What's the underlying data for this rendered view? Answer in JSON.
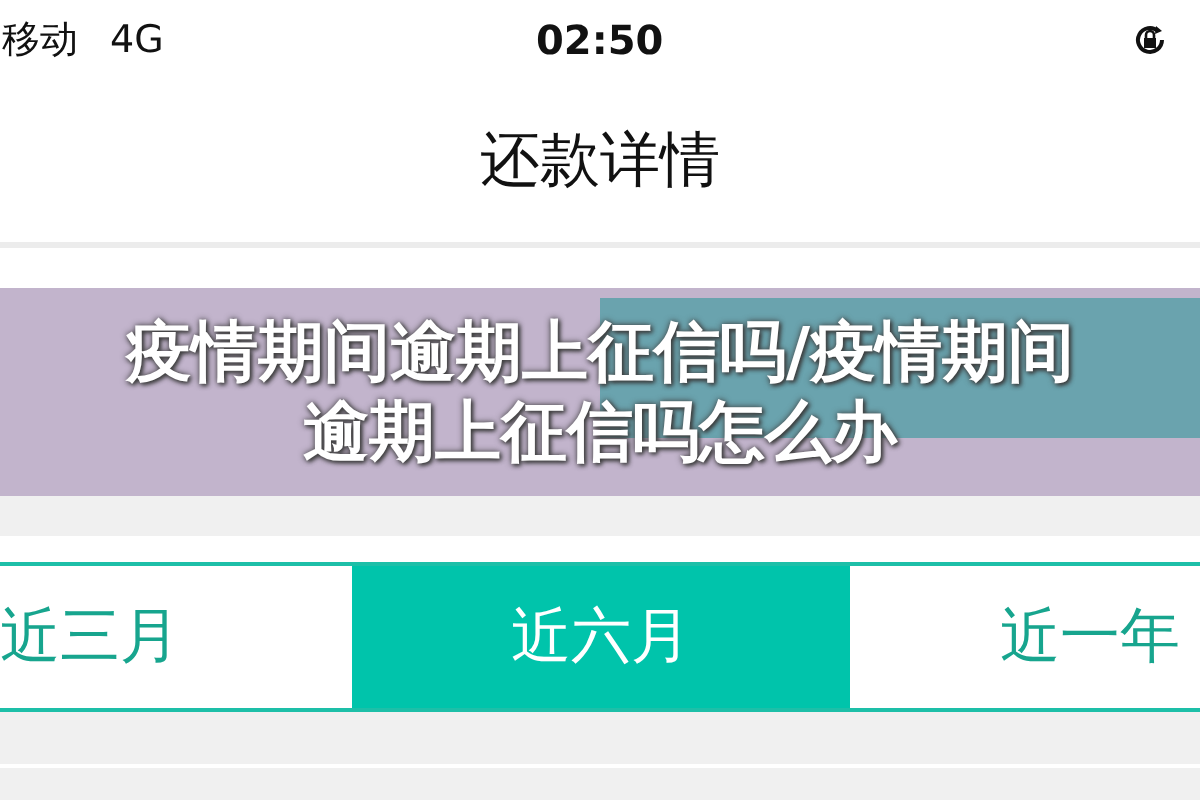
{
  "status_bar": {
    "carrier": "移动",
    "network": "4G",
    "time": "02:50"
  },
  "title": "还款详情",
  "overlay_title": "疫情期间逾期上征信吗/疫情期间逾期上征信吗怎么办",
  "period_tabs": [
    {
      "label": "近三月",
      "selected": false
    },
    {
      "label": "近六月",
      "selected": true
    },
    {
      "label": "近一年",
      "selected": false
    }
  ]
}
